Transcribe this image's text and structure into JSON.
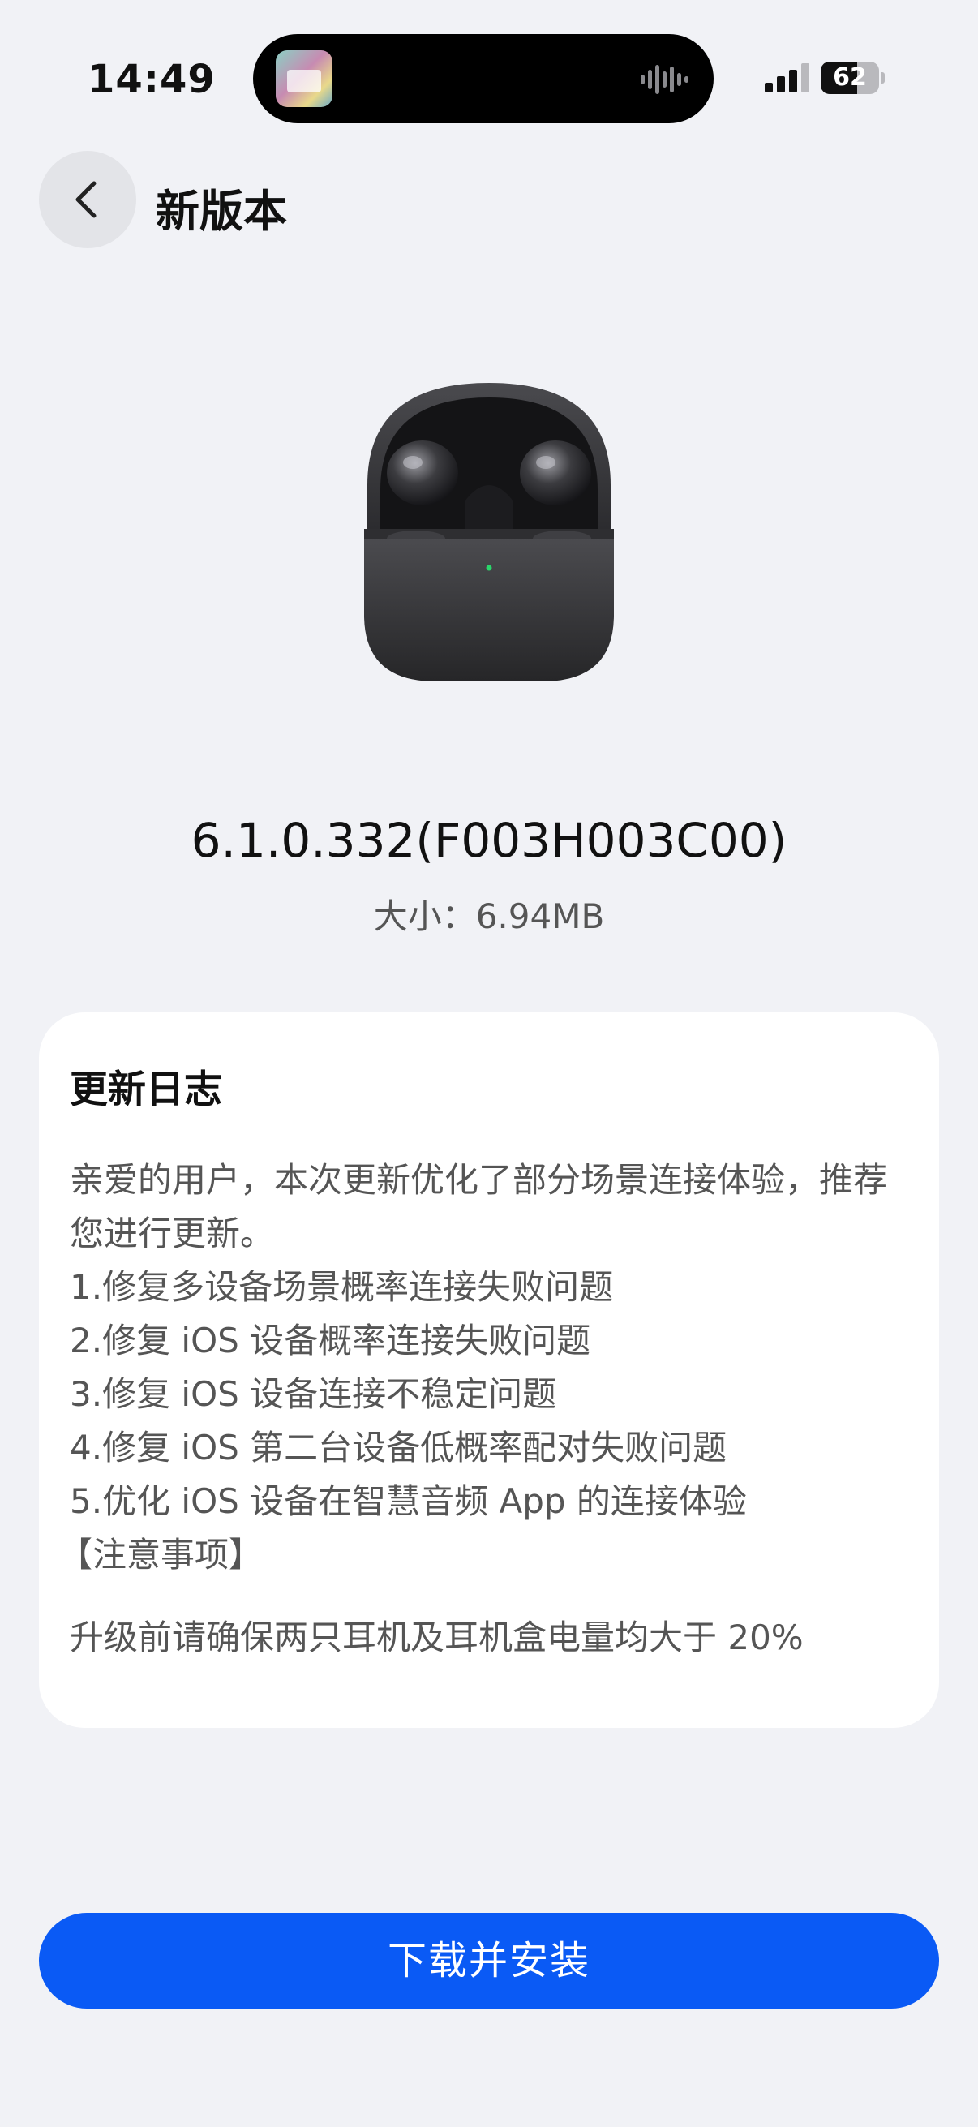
{
  "status_bar": {
    "time": "14:49",
    "battery": "62",
    "battery_level": 0.62
  },
  "header": {
    "title": "新版本"
  },
  "firmware": {
    "version": "6.1.0.332(F003H003C00)",
    "size": "大小：6.94MB"
  },
  "changelog": {
    "title": "更新日志",
    "intro": "亲爱的用户，本次更新优化了部分场景连接体验，推荐您进行更新。",
    "items": [
      "1.修复多设备场景概率连接失败问题",
      "2.修复 iOS 设备概率连接失败问题",
      "3.修复 iOS 设备连接不稳定问题",
      "4.修复 iOS 第二台设备低概率配对失败问题",
      "5.优化 iOS 设备在智慧音频 App 的连接体验"
    ],
    "notice_title": "【注意事项】",
    "notice_text": "升级前请确保两只耳机及耳机盒电量均大于 20%"
  },
  "actions": {
    "download_label": "下载并安装"
  },
  "colors": {
    "background": "#f1f2f6",
    "card": "#ffffff",
    "accent": "#0a5af5",
    "body_text": "#555555"
  },
  "icons": {
    "back": "chevron-left-icon",
    "signal": "cellular-signal-icon",
    "battery": "battery-icon",
    "audio": "audio-waveform-icon"
  }
}
